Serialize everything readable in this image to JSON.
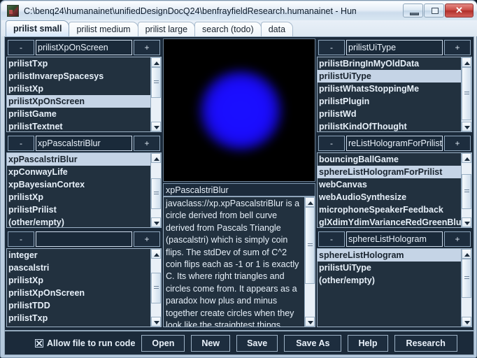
{
  "window": {
    "title": "C:\\benq24\\humanainet\\unifiedDesignDocQ24\\benfrayfieldResearch.humanainet - Human AI Net (o...",
    "icon": "app-icon",
    "minimize": "minimize-icon",
    "maximize": "maximize-icon",
    "close": "✕"
  },
  "tabs": [
    {
      "label": "prilist small",
      "active": true
    },
    {
      "label": "prilist medium",
      "active": false
    },
    {
      "label": "prilist large",
      "active": false
    },
    {
      "label": "search (todo)",
      "active": false
    },
    {
      "label": "data",
      "active": false
    }
  ],
  "panels": {
    "left_top": {
      "minus": "-",
      "plus": "+",
      "field_value": "prilistXpOnScreen",
      "field_placeholder": "",
      "items": [
        {
          "label": "prilistTxp",
          "selected": false
        },
        {
          "label": "prilistInvarepSpacesys",
          "selected": false
        },
        {
          "label": "prilistXp",
          "selected": false
        },
        {
          "label": "prilistXpOnScreen",
          "selected": true
        },
        {
          "label": "prilistGame",
          "selected": false
        },
        {
          "label": "prilistTextnet",
          "selected": false
        }
      ]
    },
    "left_mid": {
      "minus": "-",
      "plus": "+",
      "field_value": "xpPascalstriBlur",
      "field_placeholder": "",
      "items": [
        {
          "label": "xpPascalstriBlur",
          "selected": true
        },
        {
          "label": "xpConwayLife",
          "selected": false
        },
        {
          "label": "xpBayesianCortex",
          "selected": false
        },
        {
          "label": "prilistXp",
          "selected": false
        },
        {
          "label": "prilistPrilist",
          "selected": false
        },
        {
          "label": "(other/empty)",
          "selected": false
        }
      ]
    },
    "left_bottom": {
      "minus": "-",
      "plus": "+",
      "field_value": "",
      "field_placeholder": "",
      "items": [
        {
          "label": "integer",
          "selected": false
        },
        {
          "label": "pascalstri",
          "selected": false
        },
        {
          "label": "prilistXp",
          "selected": false
        },
        {
          "label": "prilistXpOnScreen",
          "selected": false
        },
        {
          "label": "prilistTDD",
          "selected": false
        },
        {
          "label": "prilistTxp",
          "selected": false
        }
      ]
    },
    "right_top": {
      "minus": "-",
      "plus": "+",
      "field_value": "prilistUiType",
      "field_placeholder": "",
      "items": [
        {
          "label": "prilistBringInMyOldData",
          "selected": false
        },
        {
          "label": "prilistUiType",
          "selected": true
        },
        {
          "label": "prilistWhatsStoppingMe",
          "selected": false
        },
        {
          "label": "prilistPlugin",
          "selected": false
        },
        {
          "label": "prilistWd",
          "selected": false
        },
        {
          "label": "prilistKindOfThought",
          "selected": false
        }
      ]
    },
    "right_mid": {
      "minus": "-",
      "plus": "+",
      "field_value": "reListHologramForPrilist",
      "field_placeholder": "",
      "items": [
        {
          "label": "bouncingBallGame",
          "selected": false
        },
        {
          "label": "sphereListHologramForPrilist",
          "selected": true
        },
        {
          "label": "webCanvas",
          "selected": false
        },
        {
          "label": "webAudioSynthesize",
          "selected": false
        },
        {
          "label": "microphoneSpeakerFeedback",
          "selected": false
        },
        {
          "label": "glXdimYdimVarianceRedGreenBlue",
          "selected": false
        }
      ]
    },
    "right_bottom": {
      "minus": "-",
      "plus": "+",
      "field_value": "sphereListHologram",
      "field_placeholder": "",
      "items": [
        {
          "label": "sphereListHologram",
          "selected": true
        },
        {
          "label": "prilistUiType",
          "selected": false
        },
        {
          "label": "(other/empty)",
          "selected": false
        }
      ]
    }
  },
  "center": {
    "canvas": {
      "graphic": "blue-gaussian-blob",
      "background_color": "#000000",
      "blob_color": "#1a0dff"
    },
    "desc_title": "xpPascalstriBlur",
    "desc_body": "javaclass://xp.xpPascalstriBlur is a circle derived from bell curve derived from Pascals Triangle (pascalstri) which is simply coin flips. The stdDev of sum of C^2 coin flips each as -1 or 1 is exactly C. Its where right triangles and circles come from. It appears as a paradox how plus and minus together create circles when they look like the straightest things there are. In the experiment you"
  },
  "bottom": {
    "checkbox_label": "Allow file to run code",
    "checkbox_checked": true,
    "buttons": [
      {
        "label": "Open"
      },
      {
        "label": "New"
      },
      {
        "label": "Save"
      },
      {
        "label": "Save As"
      },
      {
        "label": "Help"
      },
      {
        "label": "Research"
      }
    ]
  }
}
